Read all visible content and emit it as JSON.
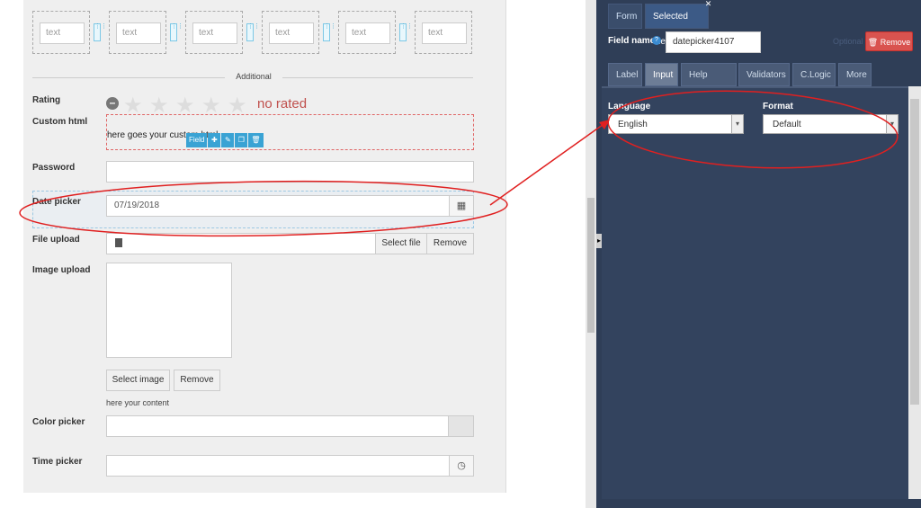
{
  "canvas": {
    "text_fields": [
      "text",
      "text",
      "text",
      "text",
      "text",
      "text"
    ],
    "section_title": "Additional",
    "rating": {
      "label": "Rating",
      "status": "no rated"
    },
    "custom_html": {
      "label": "Custom html",
      "content": "here goes your custom html"
    },
    "field_toolbar": {
      "label": "Field"
    },
    "password": {
      "label": "Password"
    },
    "date_picker": {
      "label": "Date picker",
      "value": "07/19/2018"
    },
    "file_upload": {
      "label": "File upload",
      "select_label": "Select file",
      "remove_label": "Remove"
    },
    "image_upload": {
      "label": "Image upload",
      "select_label": "Select image",
      "remove_label": "Remove",
      "note": "here your content"
    },
    "color_picker": {
      "label": "Color picker"
    },
    "time_picker": {
      "label": "Time picker"
    }
  },
  "panel": {
    "tabs": [
      {
        "label": "Form",
        "active": false
      },
      {
        "label": "Selected Field",
        "active": true
      }
    ],
    "field_name": {
      "label": "Field name",
      "value": "datepicker4107"
    },
    "optional_label": "Optional",
    "remove_label": "Remove",
    "sub_tabs": [
      {
        "label": "Label",
        "active": false
      },
      {
        "label": "Input",
        "active": true
      },
      {
        "label": "Help Block",
        "active": false
      },
      {
        "label": "Validators",
        "active": false
      },
      {
        "label": "C.Logic",
        "active": false
      },
      {
        "label": "More",
        "active": false
      }
    ],
    "language": {
      "label": "Language",
      "value": "English"
    },
    "format": {
      "label": "Format",
      "value": "Default"
    }
  },
  "colors": {
    "panel_bg": "#2f3e57",
    "accent_blue": "#3aa3d4",
    "remove_red": "#d9534f",
    "annotation_red": "#e02020",
    "rating_text": "#c0504d"
  },
  "icons": {
    "calendar": "calendar-icon",
    "file": "file-icon",
    "clock": "clock-icon",
    "trash": "trash-icon",
    "info": "info-icon",
    "close": "close-icon",
    "move": "move-icon",
    "edit": "edit-icon",
    "copy": "copy-icon"
  }
}
